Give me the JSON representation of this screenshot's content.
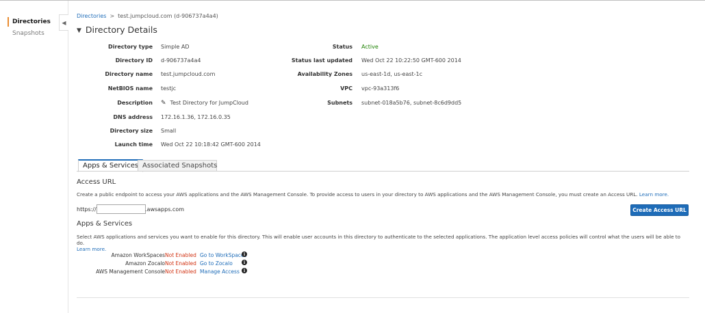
{
  "sidebar": {
    "items": [
      {
        "label": "Directories"
      },
      {
        "label": "Snapshots"
      }
    ],
    "collapse_icon": "chevron-left-icon"
  },
  "breadcrumb": {
    "root": "Directories",
    "separator": ">",
    "current": "test.jumpcloud.com (d-906737a4a4)"
  },
  "details": {
    "title": "Directory Details",
    "left": [
      {
        "label": "Directory type",
        "value": "Simple AD"
      },
      {
        "label": "Directory ID",
        "value": "d-906737a4a4"
      },
      {
        "label": "Directory name",
        "value": "test.jumpcloud.com"
      },
      {
        "label": "NetBIOS name",
        "value": "testjc"
      },
      {
        "label": "Description",
        "value": "Test Directory for JumpCloud"
      },
      {
        "label": "DNS address",
        "value": "172.16.1.36, 172.16.0.35"
      },
      {
        "label": "Directory size",
        "value": "Small"
      },
      {
        "label": "Launch time",
        "value": "Wed Oct 22 10:18:42 GMT-600 2014"
      }
    ],
    "right": [
      {
        "label": "Status",
        "value": "Active"
      },
      {
        "label": "Status last updated",
        "value": "Wed Oct 22 10:22:50 GMT-600 2014"
      },
      {
        "label": "Availability Zones",
        "value": "us-east-1d, us-east-1c"
      },
      {
        "label": "VPC",
        "value": "vpc-93a313f6"
      },
      {
        "label": "Subnets",
        "value": "subnet-018a5b76, subnet-8c6d9dd5"
      }
    ]
  },
  "tabs": [
    {
      "label": "Apps & Services"
    },
    {
      "label": "Associated Snapshots"
    }
  ],
  "access_url": {
    "heading": "Access URL",
    "description": "Create a public endpoint to access your AWS applications and the AWS Management Console. To provide access to users in your directory to AWS applications and the AWS Management Console, you must create an Access URL.",
    "learn_more": "Learn more.",
    "prefix": "https://",
    "input_value": "",
    "suffix": ".awsapps.com",
    "button": "Create Access URL"
  },
  "apps": {
    "heading": "Apps & Services",
    "description": "Select AWS applications and services you want to enable for this directory. This will enable user accounts in this directory to authenticate to the selected applications. The application level access policies will control what the users will be able to do.",
    "learn_more": "Learn more.",
    "rows": [
      {
        "name": "Amazon WorkSpaces",
        "status": "Not Enabled",
        "link": "Go to WorkSpaces"
      },
      {
        "name": "Amazon Zocalo",
        "status": "Not Enabled",
        "link": "Go to Zocalo"
      },
      {
        "name": "AWS Management Console",
        "status": "Not Enabled",
        "link": "Manage Access"
      }
    ]
  },
  "colors": {
    "link": "#1e6cb8",
    "active": "#1d8102",
    "not_enabled": "#d13212",
    "accent": "#e98b2f",
    "button": "#1e6cb8"
  }
}
